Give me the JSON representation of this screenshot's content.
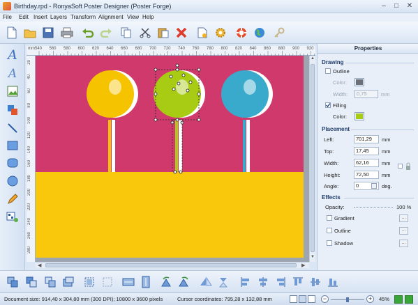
{
  "window": {
    "title": "Birthday.rpd - RonyaSoft Poster Designer (Poster Forge)"
  },
  "menu": [
    "File",
    "Edit",
    "Insert",
    "Layers",
    "Transform",
    "Alignment",
    "View",
    "Help"
  ],
  "toolbar": [
    "new-document-icon",
    "open-folder-icon",
    "save-icon",
    "print-icon",
    "undo-icon",
    "redo-icon",
    "copy-icon",
    "cut-icon",
    "paste-icon",
    "delete-icon",
    "export-icon",
    "settings-gear-icon",
    "help-lifebuoy-icon",
    "web-globe-icon",
    "key-icon"
  ],
  "ruler": {
    "top_labels": [
      "540",
      "560",
      "580",
      "600",
      "620",
      "640",
      "660",
      "680",
      "700",
      "720",
      "740",
      "760",
      "780",
      "800",
      "820",
      "840",
      "860",
      "880",
      "900",
      "920"
    ],
    "left_labels": [
      "20",
      "40",
      "60",
      "80",
      "100",
      "120",
      "140",
      "160",
      "180",
      "200",
      "220",
      "240",
      "260",
      "280"
    ],
    "unit": "mm"
  },
  "poster": {
    "top_color": "#cf396b",
    "bottom_color": "#f9c80d",
    "lollipops": [
      {
        "name": "yellow",
        "color": "#f5c300"
      },
      {
        "name": "green",
        "color": "#a8cb14"
      },
      {
        "name": "blue",
        "color": "#39aacb"
      }
    ]
  },
  "properties": {
    "title": "Properties",
    "drawing": {
      "label": "Drawing",
      "outline_label": "Outline",
      "outline_checked": false,
      "outline_color_label": "Color:",
      "outline_color": "#6a6f78",
      "width_label": "Width:",
      "width_value": "0,75",
      "width_unit": "mm",
      "filling_label": "Filling",
      "filling_checked": true,
      "fill_color_label": "Color:",
      "fill_color": "#a8cb14"
    },
    "placement": {
      "label": "Placement",
      "left_label": "Left:",
      "left_value": "701,29",
      "top_label": "Top:",
      "top_value": "17,45",
      "width_label": "Width:",
      "width_value": "62,16",
      "height_label": "Height:",
      "height_value": "72,50",
      "angle_label": "Angle:",
      "angle_value": "0",
      "unit": "mm",
      "angle_unit": "deg."
    },
    "effects": {
      "label": "Effects",
      "opacity_label": "Opacity:",
      "opacity_value": "100 %",
      "gradient_label": "Gradient",
      "outline_label": "Outline",
      "shadow_label": "Shadow",
      "more_label": "..."
    }
  },
  "status": {
    "document_size": "Document size: 914,40 x 304,80 mm (300 DPI); 10800 x 3600 pixels",
    "cursor": "Cursor coordinates: 795,28 x 132,88 mm",
    "zoom": "45%"
  }
}
